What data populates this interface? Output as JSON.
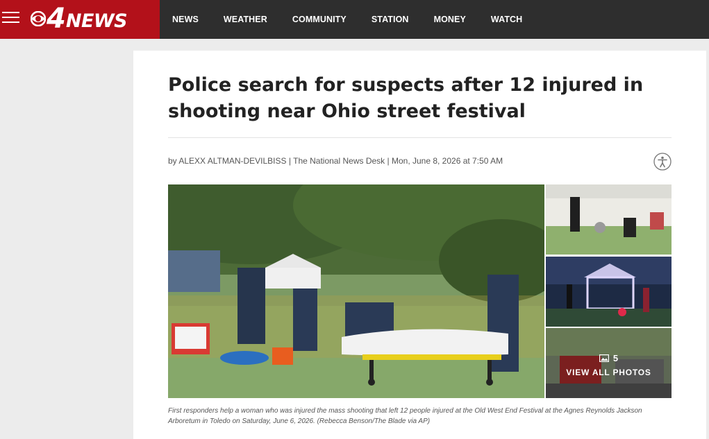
{
  "header": {
    "logo_number": "4",
    "logo_text": "NEWS",
    "nav": [
      "NEWS",
      "WEATHER",
      "COMMUNITY",
      "STATION",
      "MONEY",
      "WATCH"
    ]
  },
  "article": {
    "headline": "Police search for suspects after 12 injured in shooting near Ohio street festival",
    "byline_prefix": "by",
    "author": "ALEXX ALTMAN-DEVILBISS",
    "outlet": "The National News Desk",
    "date": "Mon, June 8, 2026 at 7:50 AM"
  },
  "gallery": {
    "photo_count": "5",
    "view_all_label": "VIEW ALL PHOTOS",
    "caption": "First responders help a woman who was injured the mass shooting that left 12 people injured at the Old West End Festival at the Agnes Reynolds Jackson Arboretum in Toledo on Saturday, June 6, 2026. (Rebecca Benson/The Blade via AP)"
  },
  "colors": {
    "brand_red": "#b3111a",
    "topbar": "#2e2e2e",
    "page_bg": "#ececec"
  }
}
